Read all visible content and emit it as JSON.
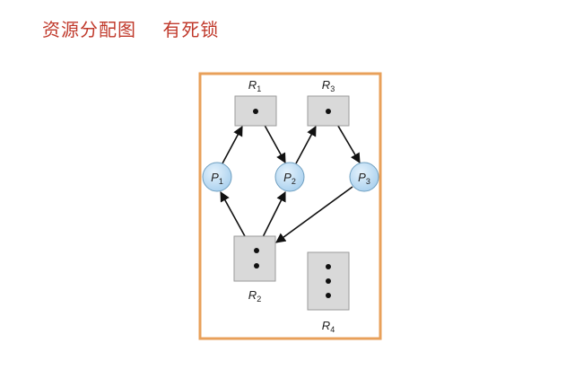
{
  "title": "资源分配图    有死锁",
  "diagram": {
    "resources": [
      {
        "id": "R1",
        "letter": "R",
        "sub": "1",
        "instances": 1
      },
      {
        "id": "R2",
        "letter": "R",
        "sub": "2",
        "instances": 2
      },
      {
        "id": "R3",
        "letter": "R",
        "sub": "3",
        "instances": 1
      },
      {
        "id": "R4",
        "letter": "R",
        "sub": "4",
        "instances": 3
      }
    ],
    "processes": [
      {
        "id": "P1",
        "letter": "P",
        "sub": "1"
      },
      {
        "id": "P2",
        "letter": "P",
        "sub": "2"
      },
      {
        "id": "P3",
        "letter": "P",
        "sub": "3"
      }
    ],
    "edges": [
      {
        "from": "P1",
        "to": "R1",
        "type": "request"
      },
      {
        "from": "R1",
        "to": "P2",
        "type": "assignment"
      },
      {
        "from": "P2",
        "to": "R3",
        "type": "request"
      },
      {
        "from": "R3",
        "to": "P3",
        "type": "assignment"
      },
      {
        "from": "P3",
        "to": "R2",
        "type": "request"
      },
      {
        "from": "R2",
        "to": "P1",
        "type": "assignment"
      },
      {
        "from": "R2",
        "to": "P2",
        "type": "assignment"
      }
    ],
    "colors": {
      "title": "#c0392b",
      "frame": "#e8a05a",
      "resource_fill": "#d9d9d9",
      "process_fill": "#bcdcf2",
      "process_stroke": "#6f9fc0",
      "edge": "#111111"
    }
  }
}
